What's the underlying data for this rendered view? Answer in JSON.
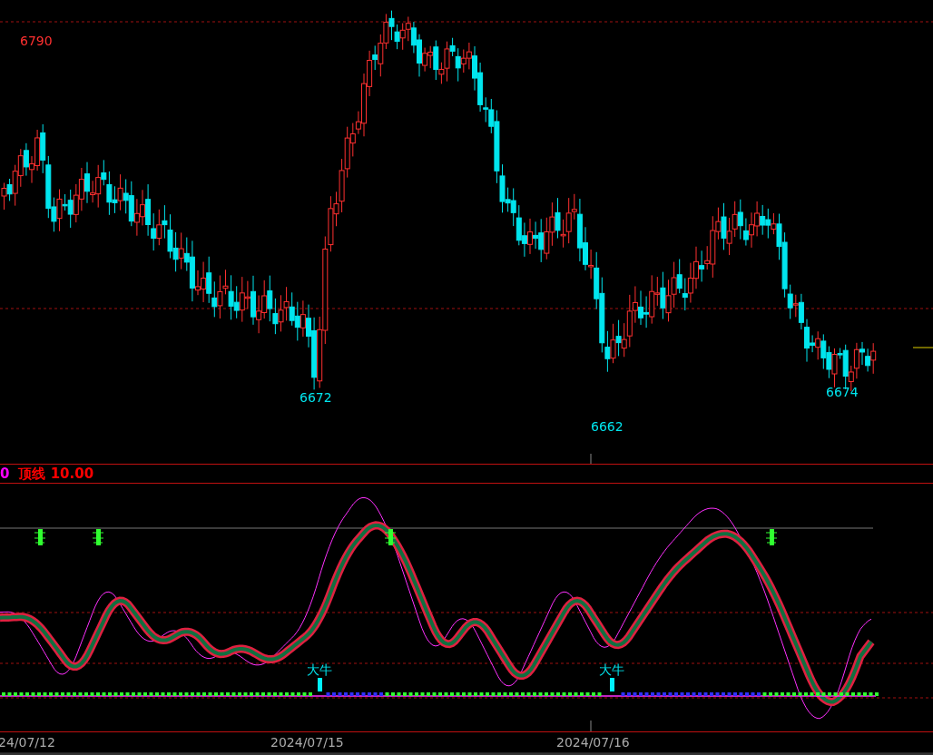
{
  "price_chart": {
    "labels": [
      {
        "text": "6790",
        "kind": "high"
      },
      {
        "text": "6672",
        "kind": "low"
      },
      {
        "text": "6662",
        "kind": "low"
      },
      {
        "text": "6674",
        "kind": "low"
      }
    ]
  },
  "indicator": {
    "legend": [
      {
        "text": "0",
        "color": "#ff00ff"
      },
      {
        "text": "顶线 10.00",
        "color": "#ff0000"
      }
    ],
    "signals": [
      "大牛",
      "大牛"
    ]
  },
  "time_axis": {
    "dates": [
      "24/07/12",
      "2024/07/15",
      "2024/07/16"
    ]
  }
}
